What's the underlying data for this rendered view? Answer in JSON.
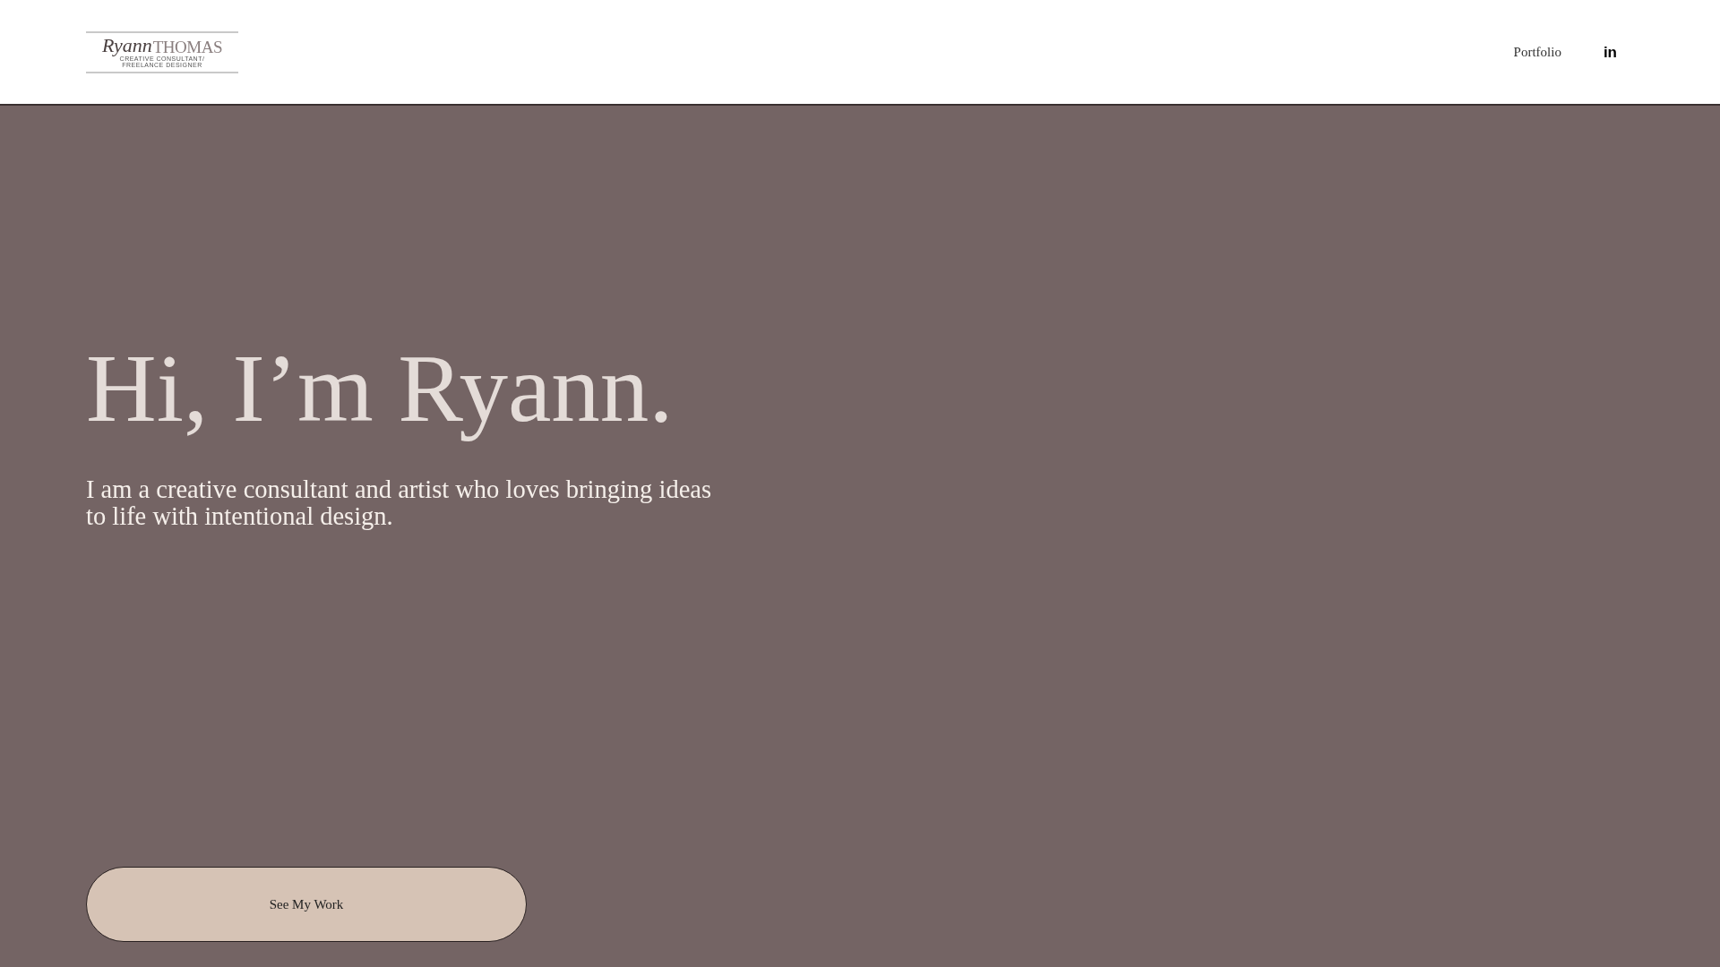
{
  "header": {
    "logo": {
      "script": "Ryann",
      "name": "THOMAS",
      "tagline_1": "CREATIVE CONSULTANT/",
      "tagline_2": "FREELANCE DESIGNER"
    },
    "nav": [
      {
        "label": "Portfolio"
      }
    ],
    "social": [
      {
        "label": "in"
      }
    ]
  },
  "hero": {
    "heading": "Hi, I’m Ryann.",
    "text": "I am a creative consultant and artist who loves bringing ideas to life with intentional design.",
    "button": "See My Work"
  }
}
